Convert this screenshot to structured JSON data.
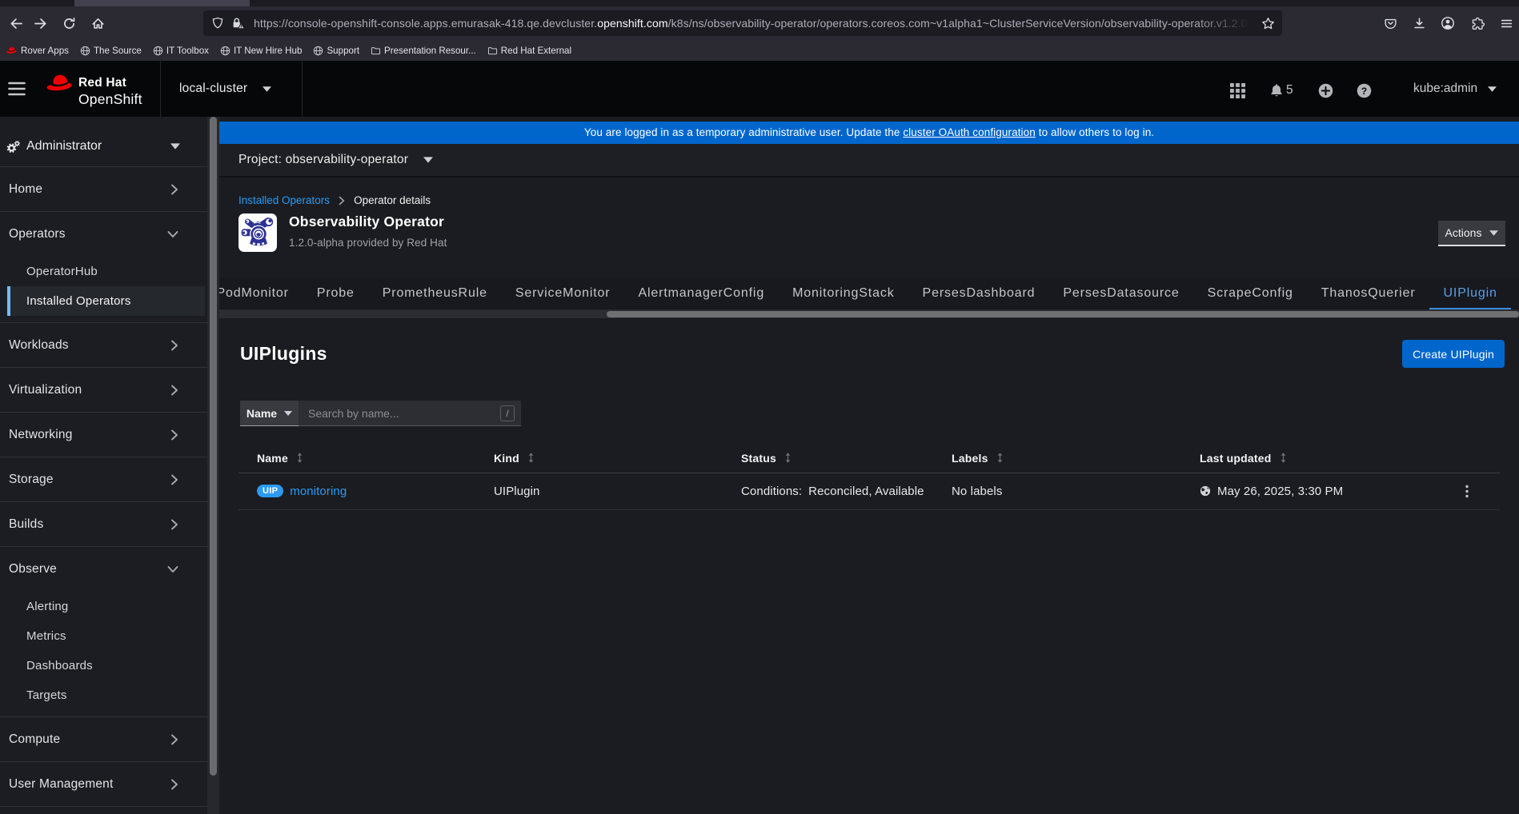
{
  "browser": {
    "url_prefix": "https://console-openshift-console.apps.emurasak-418.qe.devcluster.",
    "url_domain": "openshift.com",
    "url_path": "/k8s/ns/observability-operator/operators.coreos.com~v1alpha1~ClusterServiceVersion/observability-operator.v1.2.0",
    "bookmarks": [
      {
        "label": "Rover Apps",
        "icon": "redhat-fedora-icon"
      },
      {
        "label": "The Source",
        "icon": "globe-icon"
      },
      {
        "label": "IT Toolbox",
        "icon": "globe-icon"
      },
      {
        "label": "IT New Hire Hub",
        "icon": "globe-icon"
      },
      {
        "label": "Support",
        "icon": "globe-icon"
      },
      {
        "label": "Presentation Resour...",
        "icon": "folder-icon"
      },
      {
        "label": "Red Hat External",
        "icon": "folder-icon"
      }
    ]
  },
  "masthead": {
    "brand_line1": "Red Hat",
    "brand_line2": "OpenShift",
    "cluster_label": "local-cluster",
    "notification_count": "5",
    "user_label": "kube:admin"
  },
  "sidebar": {
    "perspective": "Administrator",
    "items": [
      {
        "label": "Home",
        "expanded": false
      },
      {
        "label": "Operators",
        "expanded": true,
        "children": [
          {
            "label": "OperatorHub",
            "active": false
          },
          {
            "label": "Installed Operators",
            "active": true
          }
        ]
      },
      {
        "label": "Workloads",
        "expanded": false
      },
      {
        "label": "Virtualization",
        "expanded": false
      },
      {
        "label": "Networking",
        "expanded": false
      },
      {
        "label": "Storage",
        "expanded": false
      },
      {
        "label": "Builds",
        "expanded": false
      },
      {
        "label": "Observe",
        "expanded": true,
        "children": [
          {
            "label": "Alerting",
            "active": false
          },
          {
            "label": "Metrics",
            "active": false
          },
          {
            "label": "Dashboards",
            "active": false
          },
          {
            "label": "Targets",
            "active": false
          }
        ]
      },
      {
        "label": "Compute",
        "expanded": false
      },
      {
        "label": "User Management",
        "expanded": false
      }
    ]
  },
  "banner": {
    "text_before": "You are logged in as a temporary administrative user. Update the ",
    "link_text": "cluster OAuth configuration",
    "text_after": " to allow others to log in."
  },
  "project_bar": {
    "label": "Project: observability-operator"
  },
  "breadcrumb": {
    "link": "Installed Operators",
    "current": "Operator details"
  },
  "operator": {
    "title": "Observability Operator",
    "subtitle": "1.2.0-alpha provided by Red Hat",
    "actions_label": "Actions"
  },
  "tabs": [
    "PodMonitor",
    "Probe",
    "PrometheusRule",
    "ServiceMonitor",
    "AlertmanagerConfig",
    "MonitoringStack",
    "PersesDashboard",
    "PersesDatasource",
    "ScrapeConfig",
    "ThanosQuerier",
    "UIPlugin"
  ],
  "active_tab": "UIPlugin",
  "list_page": {
    "title": "UIPlugins",
    "create_button": "Create UIPlugin",
    "filter": {
      "dropdown_label": "Name",
      "search_placeholder": "Search by name...",
      "shortcut_hint": "/"
    }
  },
  "table": {
    "columns": [
      "Name",
      "Kind",
      "Status",
      "Labels",
      "Last updated"
    ],
    "rows": [
      {
        "badge": "UIP",
        "name": "monitoring",
        "kind": "UIPlugin",
        "status_label": "Conditions:",
        "status_value": "Reconciled, Available",
        "labels": "No labels",
        "last_updated": "May 26, 2025, 3:30 PM"
      }
    ]
  },
  "colors": {
    "accent_blue": "#0066cc",
    "link_blue": "#2b9af3",
    "active_nav_indicator": "#73bcf7",
    "banner_blue": "#0066cc",
    "badge_blue": "#2b9af3",
    "redhat_red": "#ee0000",
    "operator_logo_indigo": "#2e3192"
  }
}
